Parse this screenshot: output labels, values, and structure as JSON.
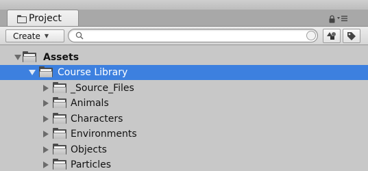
{
  "panel": {
    "tab_label": "Project",
    "tab_icon": "folder-icon",
    "lock_icon": "lock-icon",
    "menu_icon": "menu-icon"
  },
  "toolbar": {
    "create_label": "Create",
    "search_value": "",
    "search_placeholder": "",
    "filter_type_icon": "shapes-filter-icon",
    "filter_label_icon": "tag-icon"
  },
  "tree": {
    "root": {
      "label": "Assets",
      "expanded": true
    },
    "items": [
      {
        "label": "Course Library",
        "expanded": true,
        "selected": true
      },
      {
        "label": "_Source_Files",
        "expanded": false
      },
      {
        "label": "Animals",
        "expanded": false
      },
      {
        "label": "Characters",
        "expanded": false
      },
      {
        "label": "Environments",
        "expanded": false
      },
      {
        "label": "Objects",
        "expanded": false
      },
      {
        "label": "Particles",
        "expanded": false
      }
    ]
  },
  "colors": {
    "selection": "#3d80df",
    "panel_bg": "#c8c8c8"
  }
}
